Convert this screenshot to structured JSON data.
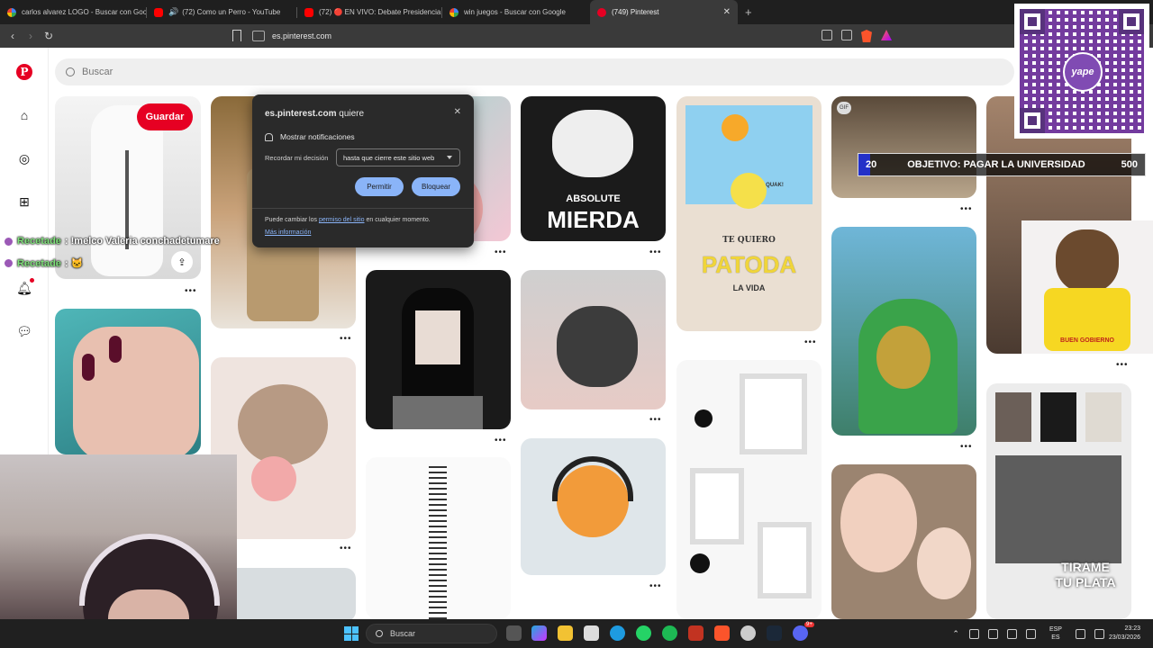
{
  "browser": {
    "tabs": [
      {
        "title": "carlos alvarez LOGO - Buscar con Goo",
        "favicon": "google-icon",
        "active": false
      },
      {
        "title": "(72) Como un Perro - YouTube",
        "favicon": "youtube-icon",
        "active": false
      },
      {
        "title": "(72) 🔴 EN VIVO: Debate Presidencia",
        "favicon": "youtube-icon",
        "active": false
      },
      {
        "title": "win juegos - Buscar con Google",
        "favicon": "google-icon",
        "active": false
      },
      {
        "title": "(749) Pinterest",
        "favicon": "pinterest-icon",
        "active": true
      }
    ],
    "new_tab": "+",
    "url": "es.pinterest.com"
  },
  "permission_prompt": {
    "site": "es.pinterest.com",
    "wants": "quiere",
    "permission": "Mostrar notificaciones",
    "remember_label": "Recordar mi decisión",
    "remember_value": "hasta que cierre este sitio web",
    "allow": "Permitir",
    "block": "Bloquear",
    "note_prefix": "Puede cambiar los",
    "note_link": "permiso del sitio",
    "note_suffix": "en cualquier momento.",
    "more_info": "Más información"
  },
  "pinterest": {
    "search_placeholder": "Buscar",
    "save_button": "Guardar",
    "gif_badge": "GIF",
    "more_label": "•••",
    "pin_texts": {
      "absolute": "ABSOLUTE",
      "mierda": "MIERDA",
      "te_quiero": "TE QUIERO",
      "patoda": "PATODA",
      "la_vida": "LA VIDA",
      "quack": "QUAK!",
      "buen_gobierno": "BUEN GOBIERNO"
    },
    "notification_dot_color": "#e60023"
  },
  "overlays": {
    "chat": [
      {
        "user": "Recetade",
        "message": ": !melco Valeria conchadetumare"
      },
      {
        "user": "Recetade",
        "message": ": 🐱"
      }
    ],
    "goal": {
      "current": "20",
      "label": "OBJETIVO: PAGAR LA UNIVERSIDAD",
      "target": "500",
      "progress": 0.04
    },
    "qr_label": "yape",
    "tip_text_line1": "TIRAME",
    "tip_text_line2": "TU PLATA"
  },
  "taskbar": {
    "search_placeholder": "Buscar",
    "lang_line1": "ESP",
    "lang_line2": "ES",
    "time": "23:23",
    "date": "23/03/2026",
    "badge": "9+"
  }
}
